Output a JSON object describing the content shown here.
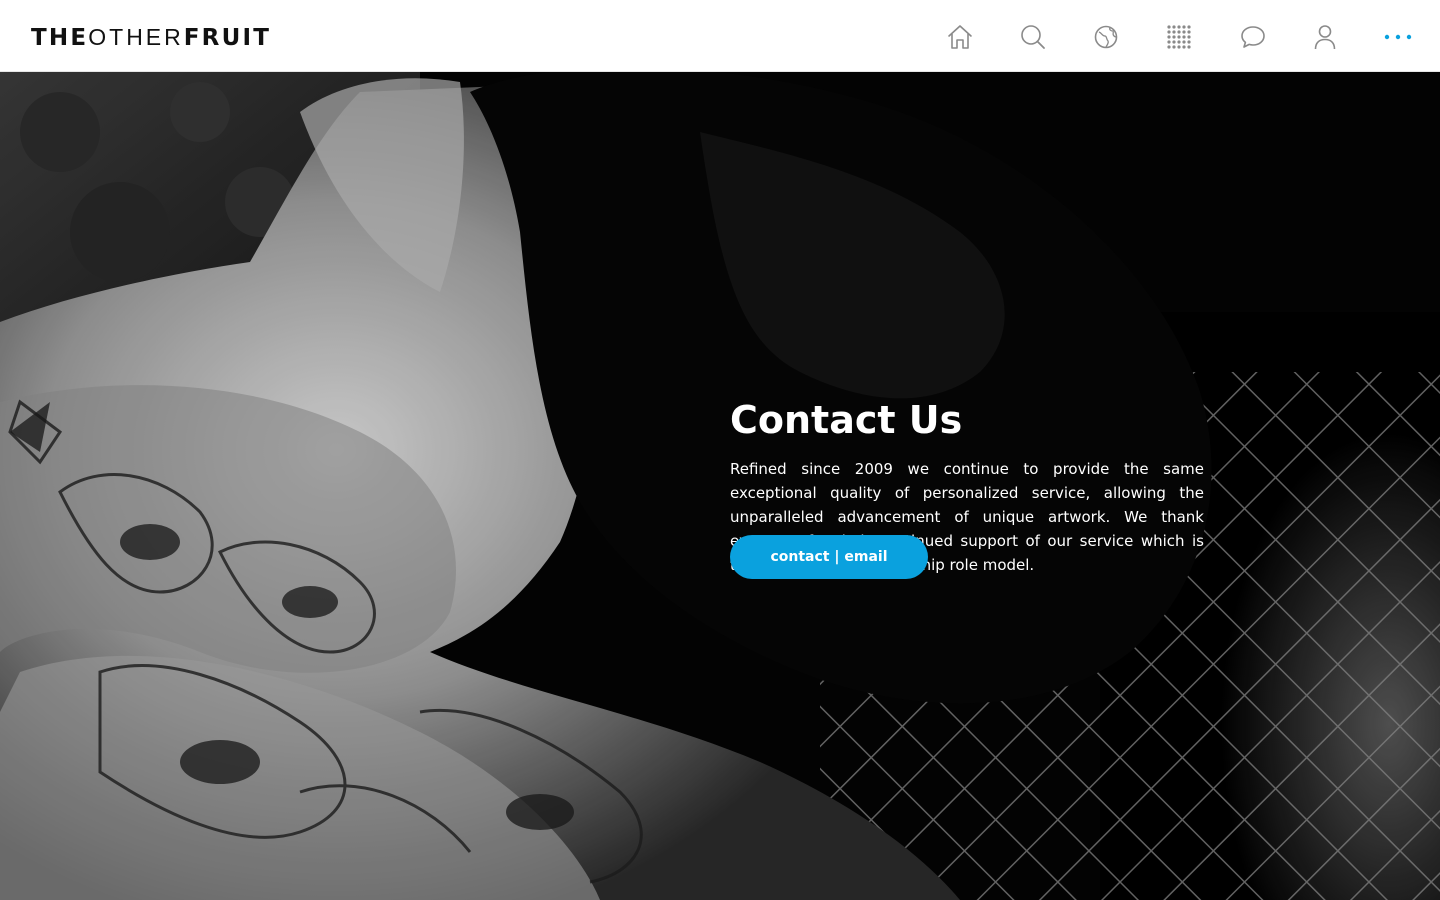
{
  "brand": {
    "logo_part1": "THE",
    "logo_part2": "OTHER",
    "logo_part3": "FRUIT"
  },
  "nav": {
    "icons": [
      "home-icon",
      "search-icon",
      "globe-icon",
      "grid-dots-icon",
      "chat-bubble-icon",
      "user-icon",
      "more-dots-icon"
    ],
    "active_color": "#0aa1de",
    "icon_color": "#8a8a8a"
  },
  "hero": {
    "title": "Contact Us",
    "body": "Refined since 2009 we continue to provide the same exceptional quality of personalized service, allowing the unparalleled advancement of unique artwork. We thank everyone for their continued support of our service which is today the industry’s flagship role model.",
    "cta_label": "contact | email",
    "cta_color": "#0aa1de"
  }
}
